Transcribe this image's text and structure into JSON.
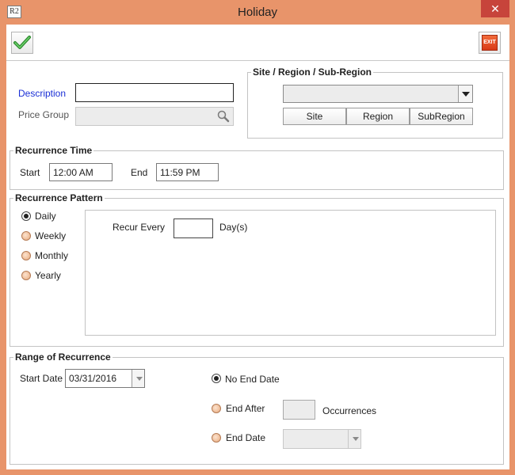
{
  "window": {
    "title": "Holiday",
    "app_icon_text": "R2",
    "close_glyph": "✕"
  },
  "toolbar": {
    "ok_icon": "checkmark-icon",
    "exit_label": "EXIT"
  },
  "form": {
    "description_label": "Description",
    "description_value": "",
    "price_group_label": "Price Group",
    "price_group_value": ""
  },
  "site_region": {
    "title": "Site / Region / Sub-Region",
    "selected": "",
    "buttons": [
      "Site",
      "Region",
      "SubRegion"
    ]
  },
  "recurrence_time": {
    "title": "Recurrence Time",
    "start_label": "Start",
    "start_value": "12:00 AM",
    "end_label": "End",
    "end_value": "11:59 PM"
  },
  "recurrence_pattern": {
    "title": "Recurrence Pattern",
    "options": [
      "Daily",
      "Weekly",
      "Monthly",
      "Yearly"
    ],
    "selected": "Daily",
    "recur_every_label": "Recur Every",
    "recur_every_value": "",
    "unit_label": "Day(s)"
  },
  "range": {
    "title": "Range of Recurrence",
    "start_date_label": "Start Date",
    "start_date_value": "03/31/2016",
    "no_end_label": "No End Date",
    "end_after_label": "End After",
    "end_after_value": "",
    "occurrences_label": "Occurrences",
    "end_date_label": "End Date",
    "end_date_value": "",
    "selected": "No End Date"
  },
  "colors": {
    "frame": "#e8946a",
    "description_label": "#1a2fd6",
    "close_button": "#c7443b"
  }
}
